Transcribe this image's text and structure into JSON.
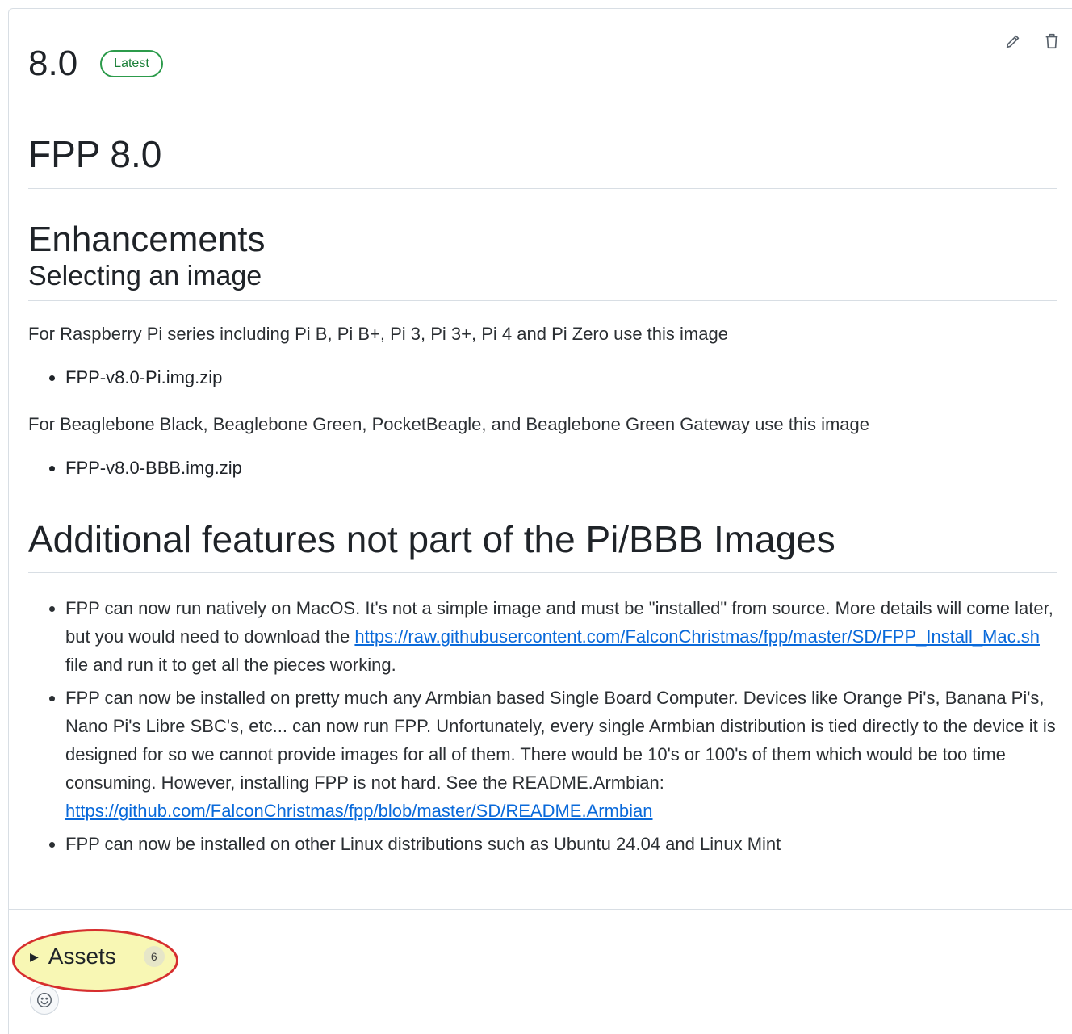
{
  "release": {
    "version": "8.0",
    "badge": "Latest",
    "title": "FPP 8.0"
  },
  "notes": {
    "enhancements_heading": "Enhancements",
    "selecting_heading": "Selecting an image",
    "pi_text": "For Raspberry Pi series including Pi B, Pi B+, Pi 3, Pi 3+, Pi 4 and Pi Zero use this image",
    "pi_file": "FPP-v8.0-Pi.img.zip",
    "bbb_text": "For Beaglebone Black, Beaglebone Green, PocketBeagle, and Beaglebone Green Gateway use this image",
    "bbb_file": "FPP-v8.0-BBB.img.zip",
    "additional_heading": "Additional features not part of the Pi/BBB Images",
    "feature1_pre": "FPP can now run natively on MacOS. It's not a simple image and must be \"installed\" from source. More details will come later, but you would need to download the ",
    "feature1_link": "https://raw.githubusercontent.com/FalconChristmas/fpp/master/SD/FPP_Install_Mac.sh",
    "feature1_post": " file and run it to get all the pieces working.",
    "feature2_pre": "FPP can now be installed on pretty much any Armbian based Single Board Computer. Devices like Orange Pi's, Banana Pi's, Nano Pi's Libre SBC's, etc... can now run FPP. Unfortunately, every single Armbian distribution is tied directly to the device it is designed for so we cannot provide images for all of them. There would be 10's or 100's of them which would be too time consuming. However, installing FPP is not hard. See the README.Armbian: ",
    "feature2_link": "https://github.com/FalconChristmas/fpp/blob/master/SD/README.Armbian",
    "feature3": "FPP can now be installed on other Linux distributions such as Ubuntu 24.04 and Linux Mint"
  },
  "assets": {
    "label": "Assets",
    "count": "6"
  },
  "colors": {
    "link": "#0969da",
    "badge_green": "#1a7f37",
    "highlight_fill": "#f8f7b4",
    "highlight_stroke": "#d62e2e"
  },
  "icons": {
    "edit": "pencil-icon",
    "delete": "trash-icon",
    "expand": "caret-right-icon",
    "reaction": "smiley-icon"
  }
}
